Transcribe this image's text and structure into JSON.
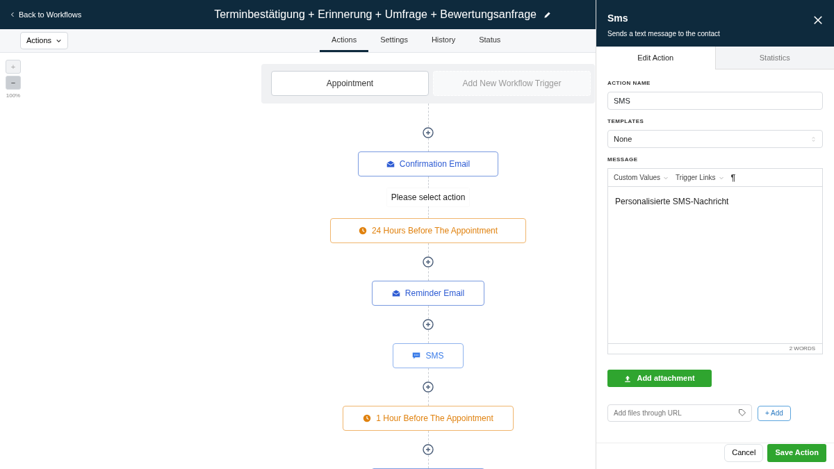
{
  "header": {
    "back_link": "Back to Workflows",
    "title": "Terminbestätigung + Erinnerung + Umfrage + Bewertungsanfrage"
  },
  "toolbar": {
    "actions_menu": "Actions",
    "tabs": [
      {
        "label": "Actions",
        "selected": true
      },
      {
        "label": "Settings",
        "selected": false
      },
      {
        "label": "History",
        "selected": false
      },
      {
        "label": "Status",
        "selected": false
      }
    ]
  },
  "zoom": {
    "zoom_in": "+",
    "zoom_out": "−",
    "zoom_in_disabled": true,
    "level_text": "100%"
  },
  "triggers": [
    {
      "label": "Appointment",
      "kind": "trigger"
    },
    {
      "label": "Add New Workflow Trigger",
      "kind": "add"
    }
  ],
  "flow": [
    {
      "kind": "add"
    },
    {
      "kind": "email",
      "label": "Confirmation Email"
    },
    {
      "kind": "note",
      "label": "Please select action"
    },
    {
      "kind": "wait",
      "label": "24 Hours Before The Appointment"
    },
    {
      "kind": "add"
    },
    {
      "kind": "email",
      "label": "Reminder Email"
    },
    {
      "kind": "add"
    },
    {
      "kind": "sms",
      "label": "SMS"
    },
    {
      "kind": "add"
    },
    {
      "kind": "wait",
      "label": "1 Hour Before The Appointment"
    },
    {
      "kind": "add"
    },
    {
      "kind": "cut"
    }
  ],
  "panel": {
    "title": "Sms",
    "subtitle": "Sends a text message to the contact",
    "tabs": [
      {
        "label": "Edit Action",
        "selected": true
      },
      {
        "label": "Statistics",
        "selected": false
      }
    ],
    "action_name": {
      "label": "ACTION NAME",
      "value": "SMS"
    },
    "templates": {
      "label": "TEMPLATES",
      "value": "None"
    },
    "message": {
      "label": "MESSAGE",
      "menus": [
        "Custom Values",
        "Trigger Links"
      ],
      "paragraph_button": "¶",
      "text": "Personalisierte SMS-Nachricht",
      "word_count": "2 WORDS"
    },
    "attachment_button": "Add attachment",
    "url_field": {
      "placeholder": "Add files through URL"
    },
    "add_button": "+ Add",
    "cancel_button": "Cancel",
    "save_button": "Save Action"
  }
}
